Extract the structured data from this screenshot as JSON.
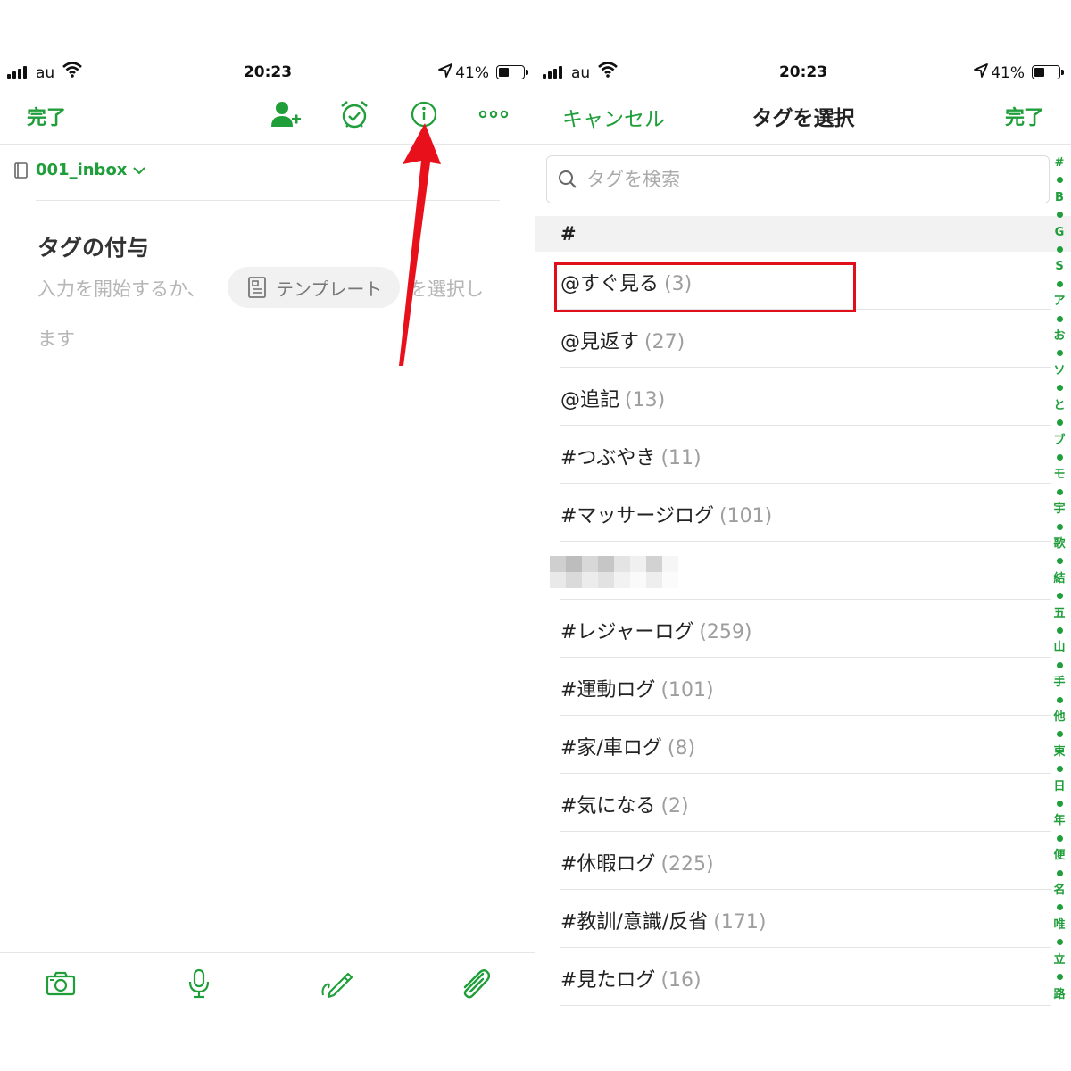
{
  "status": {
    "carrier": "au",
    "time": "20:23",
    "battery": "41%"
  },
  "left": {
    "done_label": "完了",
    "notebook": "001_inbox",
    "note_title": "タグの付与",
    "hint_before": "入力を開始するか、",
    "template_label": "テンプレート",
    "hint_after": "を選択し",
    "hint_line2": "ます",
    "toolbar_icons": [
      "add-user-icon",
      "alarm-icon",
      "info-icon",
      "more-icon"
    ],
    "bottom_icons": [
      "camera-icon",
      "microphone-icon",
      "handwriting-icon",
      "paperclip-icon"
    ]
  },
  "right": {
    "cancel_label": "キャンセル",
    "title": "タグを選択",
    "done_label": "完了",
    "search_placeholder": "タグを検索",
    "section_header": "#",
    "tags": [
      {
        "name": "@すぐ見る",
        "count": "(3)"
      },
      {
        "name": "@見返す",
        "count": "(27)"
      },
      {
        "name": "@追記",
        "count": "(13)"
      },
      {
        "name": "#つぶやき",
        "count": "(11)"
      },
      {
        "name": "#マッサージログ",
        "count": "(101)"
      },
      {
        "name": "",
        "count": "",
        "blurred": true
      },
      {
        "name": "#レジャーログ",
        "count": "(259)"
      },
      {
        "name": "#運動ログ",
        "count": "(101)"
      },
      {
        "name": "#家/車ログ",
        "count": "(8)"
      },
      {
        "name": "#気になる",
        "count": "(2)"
      },
      {
        "name": "#休暇ログ",
        "count": "(225)"
      },
      {
        "name": "#教訓/意識/反省",
        "count": "(171)"
      },
      {
        "name": "#見たログ",
        "count": "(16)"
      }
    ],
    "index": [
      "#",
      "B",
      "G",
      "S",
      "ア",
      "お",
      "ソ",
      "と",
      "ブ",
      "モ",
      "宇",
      "歌",
      "結",
      "五",
      "山",
      "手",
      "他",
      "東",
      "日",
      "年",
      "便",
      "名",
      "唯",
      "立",
      "路"
    ]
  },
  "colors": {
    "accent": "#1f9e3a",
    "highlight": "#e0101a"
  }
}
